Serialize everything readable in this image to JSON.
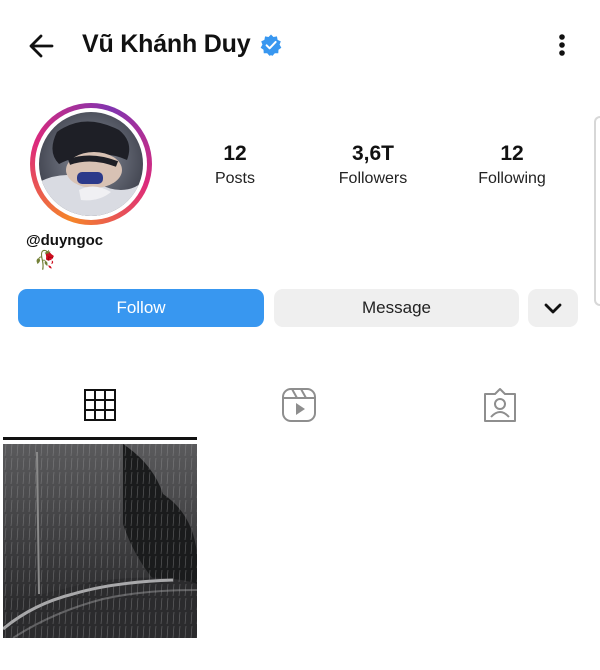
{
  "header": {
    "title": "Vũ Khánh Duy",
    "verified": true,
    "back_icon": "arrow-left-icon",
    "more_icon": "more-vertical-icon"
  },
  "profile": {
    "handle": "@duyngoc",
    "bio_emoji": "🥀",
    "stats": [
      {
        "value": "12",
        "label": "Posts"
      },
      {
        "value": "3,6T",
        "label": "Followers"
      },
      {
        "value": "12",
        "label": "Following"
      }
    ]
  },
  "actions": {
    "follow_label": "Follow",
    "message_label": "Message",
    "dropdown_icon": "chevron-down-icon"
  },
  "tabs": [
    {
      "name": "grid",
      "icon": "grid-icon",
      "active": true
    },
    {
      "name": "reels",
      "icon": "reels-icon",
      "active": false
    },
    {
      "name": "tagged",
      "icon": "tagged-user-icon",
      "active": false
    }
  ],
  "colors": {
    "accent": "#3897f0",
    "button_gray": "#efefef",
    "verified_blue": "#3897f0"
  }
}
